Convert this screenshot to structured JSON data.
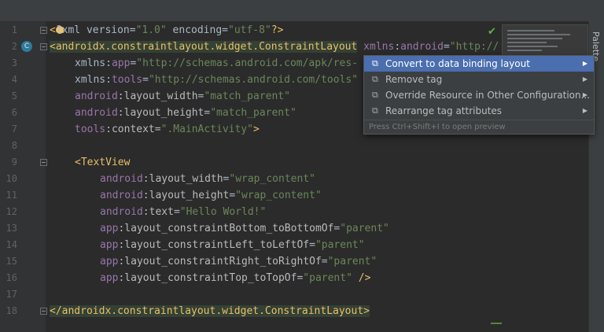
{
  "editor": {
    "lines": [
      {
        "n": "1",
        "parts": [
          [
            "tag",
            "<"
          ],
          [
            "plain",
            "?xml version="
          ],
          [
            "val",
            "\"1.0\""
          ],
          [
            "plain",
            " encoding="
          ],
          [
            "val",
            "\"utf-8\""
          ],
          [
            "tag",
            "?>"
          ]
        ]
      },
      {
        "n": "2",
        "parts": [
          [
            "tag",
            "<androidx.constraintlayout.widget.ConstraintLayout"
          ],
          [
            "plain",
            " "
          ],
          [
            "ns",
            "xmlns"
          ],
          [
            "attr",
            ":"
          ],
          [
            "ns",
            "android"
          ],
          [
            "plain",
            "="
          ],
          [
            "val",
            "\"http://"
          ]
        ]
      },
      {
        "n": "3",
        "parts": [
          [
            "plain",
            "xmlns:"
          ],
          [
            "ns",
            "app"
          ],
          [
            "plain",
            "="
          ],
          [
            "val",
            "\"http://schemas.android.com/apk/res-"
          ]
        ]
      },
      {
        "n": "4",
        "parts": [
          [
            "plain",
            "xmlns:"
          ],
          [
            "ns",
            "tools"
          ],
          [
            "plain",
            "="
          ],
          [
            "val",
            "\"http://schemas.android.com/tools\""
          ]
        ]
      },
      {
        "n": "5",
        "parts": [
          [
            "ns",
            "android"
          ],
          [
            "attr",
            ":layout_width"
          ],
          [
            "plain",
            "="
          ],
          [
            "val",
            "\"match_parent\""
          ]
        ]
      },
      {
        "n": "6",
        "parts": [
          [
            "ns",
            "android"
          ],
          [
            "attr",
            ":layout_height"
          ],
          [
            "plain",
            "="
          ],
          [
            "val",
            "\"match_parent\""
          ]
        ]
      },
      {
        "n": "7",
        "parts": [
          [
            "ns",
            "tools"
          ],
          [
            "attr",
            ":context"
          ],
          [
            "plain",
            "="
          ],
          [
            "val",
            "\".MainActivity\""
          ],
          [
            "tag",
            ">"
          ]
        ]
      },
      {
        "n": "8",
        "parts": []
      },
      {
        "n": "9",
        "parts": [
          [
            "tag",
            "<TextView"
          ]
        ]
      },
      {
        "n": "10",
        "parts": [
          [
            "ns",
            "android"
          ],
          [
            "attr",
            ":layout_width"
          ],
          [
            "plain",
            "="
          ],
          [
            "val",
            "\"wrap_content\""
          ]
        ]
      },
      {
        "n": "11",
        "parts": [
          [
            "ns",
            "android"
          ],
          [
            "attr",
            ":layout_height"
          ],
          [
            "plain",
            "="
          ],
          [
            "val",
            "\"wrap_content\""
          ]
        ]
      },
      {
        "n": "12",
        "parts": [
          [
            "ns",
            "android"
          ],
          [
            "attr",
            ":text"
          ],
          [
            "plain",
            "="
          ],
          [
            "val",
            "\"Hello World!\""
          ]
        ]
      },
      {
        "n": "13",
        "parts": [
          [
            "ns",
            "app"
          ],
          [
            "attr",
            ":layout_constraintBottom_toBottomOf"
          ],
          [
            "plain",
            "="
          ],
          [
            "val",
            "\"parent\""
          ]
        ]
      },
      {
        "n": "14",
        "parts": [
          [
            "ns",
            "app"
          ],
          [
            "attr",
            ":layout_constraintLeft_toLeftOf"
          ],
          [
            "plain",
            "="
          ],
          [
            "val",
            "\"parent\""
          ]
        ]
      },
      {
        "n": "15",
        "parts": [
          [
            "ns",
            "app"
          ],
          [
            "attr",
            ":layout_constraintRight_toRightOf"
          ],
          [
            "plain",
            "="
          ],
          [
            "val",
            "\"parent\""
          ]
        ]
      },
      {
        "n": "16",
        "parts": [
          [
            "ns",
            "app"
          ],
          [
            "attr",
            ":layout_constraintTop_toTopOf"
          ],
          [
            "plain",
            "="
          ],
          [
            "val",
            "\"parent\""
          ],
          [
            "tag",
            " />"
          ]
        ]
      },
      {
        "n": "17",
        "parts": []
      },
      {
        "n": "18",
        "parts": [
          [
            "tag",
            "</androidx.constraintlayout.widget.ConstraintLayout>"
          ]
        ]
      }
    ],
    "class_badge": "C"
  },
  "popup": {
    "items": [
      {
        "label": "Convert to data binding layout",
        "icon": "refactor-icon",
        "selected": true
      },
      {
        "label": "Remove tag",
        "icon": "refactor-icon",
        "selected": false
      },
      {
        "label": "Override Resource in Other Configuration...",
        "icon": "refactor-icon",
        "selected": false
      },
      {
        "label": "Rearrange tag attributes",
        "icon": "refactor-icon",
        "selected": false
      }
    ],
    "hint": "Press Ctrl+Shift+I to open preview"
  },
  "sidebar": {
    "palette_label": "Palette"
  },
  "colors": {
    "tag": "#e8bf6a",
    "namespace": "#9876aa",
    "value": "#6a8759",
    "selection": "#4b6eaf"
  }
}
